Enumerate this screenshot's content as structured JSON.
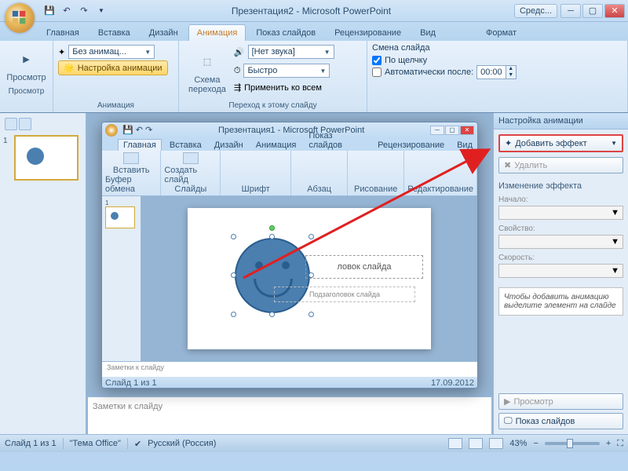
{
  "title": "Презентация2 - Microsoft PowerPoint",
  "extra_button": "Средс...",
  "tabs": [
    "Главная",
    "Вставка",
    "Дизайн",
    "Анимация",
    "Показ слайдов",
    "Рецензирование",
    "Вид",
    "Формат"
  ],
  "active_tab": 3,
  "ribbon": {
    "preview": {
      "label": "Просмотр",
      "group": "Просмотр"
    },
    "anim": {
      "no_anim": "Без анимац...",
      "custom": "Настройка анимации",
      "group": "Анимация"
    },
    "transition": {
      "scheme": "Схема\nперехода",
      "sound": "[Нет звука]",
      "speed": "Быстро",
      "apply_all": "Применить ко всем",
      "group": "Переход к этому слайду"
    },
    "advance": {
      "title": "Смена слайда",
      "on_click": "По щелчку",
      "auto_after": "Автоматически после:",
      "time": "00:00"
    }
  },
  "thumbs": {
    "slide_num": "1"
  },
  "inner": {
    "title": "Презентация1 - Microsoft PowerPoint",
    "tabs": [
      "Главная",
      "Вставка",
      "Дизайн",
      "Анимация",
      "Показ слайдов",
      "Рецензирование",
      "Вид"
    ],
    "ribbon_groups": [
      "Буфер обмена",
      "Слайды",
      "Шрифт",
      "Абзац",
      "Рисование",
      "Редактирование"
    ],
    "insert": "Вставить",
    "create_slide": "Создать слайд",
    "title_ph": "ловок слайда",
    "sub_ph": "Подзаголовок слайда",
    "notes": "Заметки к слайду",
    "status_left": "Слайд 1 из 1",
    "status_date": "17.09.2012"
  },
  "notes": "Заметки к слайду",
  "taskpane": {
    "header": "Настройка анимации",
    "add_effect": "Добавить эффект",
    "delete": "Удалить",
    "change_section": "Изменение эффекта",
    "start": "Начало:",
    "property": "Свойство:",
    "speed": "Скорость:",
    "hint": "Чтобы добавить анимацию выделите элемент на слайде",
    "play": "Просмотр",
    "slideshow": "Показ слайдов"
  },
  "status": {
    "slide_info": "Слайд 1 из 1",
    "theme": "\"Тема Office\"",
    "lang": "Русский (Россия)",
    "zoom": "43%"
  }
}
